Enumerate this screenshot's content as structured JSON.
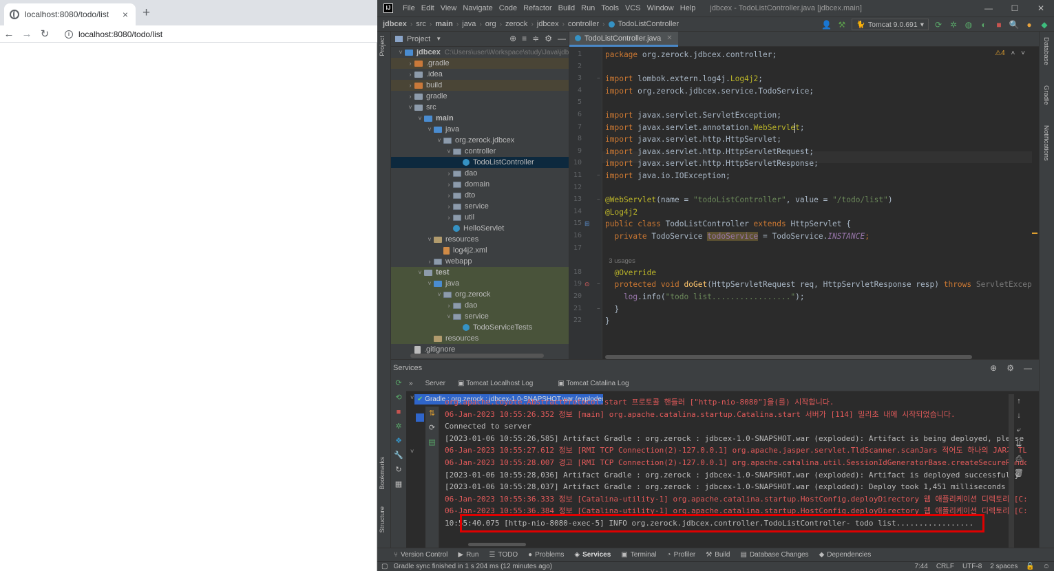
{
  "browser": {
    "tab_title": "localhost:8080/todo/list",
    "tab_close": "×",
    "new_tab": "+",
    "back": "←",
    "forward": "→",
    "reload": "↻",
    "url": "localhost:8080/todo/list"
  },
  "ide": {
    "logo": "IJ",
    "menu": [
      "File",
      "Edit",
      "View",
      "Navigate",
      "Code",
      "Refactor",
      "Build",
      "Run",
      "Tools",
      "VCS",
      "Window",
      "Help"
    ],
    "window_title": "jdbcex - TodoListController.java [jdbcex.main]",
    "win_min": "—",
    "win_max": "☐",
    "win_close": "✕",
    "breadcrumbs": [
      "jdbcex",
      "src",
      "main",
      "java",
      "org",
      "zerock",
      "jdbcex",
      "controller",
      "TodoListController"
    ],
    "run_config": "Tomcat 9.0.691",
    "left_strip": [
      "Project",
      "Bookmarks",
      "Structure"
    ],
    "right_strip": [
      "Database",
      "Gradle",
      "Notifications"
    ],
    "project_panel": {
      "title": "Project",
      "root_path": "C:\\Users\\user\\Workspace\\study\\Java\\jdb",
      "tree": [
        {
          "label": "jdbcex",
          "indent": 0,
          "arrow": "v",
          "icon": "blue",
          "bold": true,
          "bg": "",
          "path": true
        },
        {
          "label": ".gradle",
          "indent": 1,
          "arrow": ">",
          "icon": "orange",
          "bg": "brown"
        },
        {
          "label": ".idea",
          "indent": 1,
          "arrow": ">",
          "icon": "folder",
          "bg": ""
        },
        {
          "label": "build",
          "indent": 1,
          "arrow": ">",
          "icon": "orange",
          "bg": "brown"
        },
        {
          "label": "gradle",
          "indent": 1,
          "arrow": ">",
          "icon": "folder",
          "bg": ""
        },
        {
          "label": "src",
          "indent": 1,
          "arrow": "v",
          "icon": "folder",
          "bg": ""
        },
        {
          "label": "main",
          "indent": 2,
          "arrow": "v",
          "icon": "blue",
          "bold": true,
          "bg": ""
        },
        {
          "label": "java",
          "indent": 3,
          "arrow": "v",
          "icon": "blue",
          "bg": ""
        },
        {
          "label": "org.zerock.jdbcex",
          "indent": 4,
          "arrow": "v",
          "icon": "pkg",
          "bg": ""
        },
        {
          "label": "controller",
          "indent": 5,
          "arrow": "v",
          "icon": "pkg",
          "bg": ""
        },
        {
          "label": "TodoListController",
          "indent": 6,
          "arrow": "",
          "icon": "class",
          "bg": "sel"
        },
        {
          "label": "dao",
          "indent": 5,
          "arrow": ">",
          "icon": "pkg",
          "bg": ""
        },
        {
          "label": "domain",
          "indent": 5,
          "arrow": ">",
          "icon": "pkg",
          "bg": ""
        },
        {
          "label": "dto",
          "indent": 5,
          "arrow": ">",
          "icon": "pkg",
          "bg": ""
        },
        {
          "label": "service",
          "indent": 5,
          "arrow": ">",
          "icon": "pkg",
          "bg": ""
        },
        {
          "label": "util",
          "indent": 5,
          "arrow": ">",
          "icon": "pkg",
          "bg": ""
        },
        {
          "label": "HelloServlet",
          "indent": 5,
          "arrow": "",
          "icon": "class",
          "bg": ""
        },
        {
          "label": "resources",
          "indent": 3,
          "arrow": "v",
          "icon": "res",
          "bg": ""
        },
        {
          "label": "log4j2.xml",
          "indent": 4,
          "arrow": "",
          "icon": "xml",
          "bg": ""
        },
        {
          "label": "webapp",
          "indent": 3,
          "arrow": ">",
          "icon": "pkg",
          "bg": ""
        },
        {
          "label": "test",
          "indent": 2,
          "arrow": "v",
          "icon": "folder",
          "bold": true,
          "bg": "olive"
        },
        {
          "label": "java",
          "indent": 3,
          "arrow": "v",
          "icon": "blue",
          "bg": "olive"
        },
        {
          "label": "org.zerock",
          "indent": 4,
          "arrow": "v",
          "icon": "pkg",
          "bg": "olive"
        },
        {
          "label": "dao",
          "indent": 5,
          "arrow": ">",
          "icon": "pkg",
          "bg": "olive"
        },
        {
          "label": "service",
          "indent": 5,
          "arrow": "v",
          "icon": "pkg",
          "bg": "olive"
        },
        {
          "label": "TodoServiceTests",
          "indent": 6,
          "arrow": "",
          "icon": "class",
          "bg": "olive"
        },
        {
          "label": "resources",
          "indent": 3,
          "arrow": "",
          "icon": "res",
          "bg": "olive"
        },
        {
          "label": ".gitignore",
          "indent": 1,
          "arrow": "",
          "icon": "file",
          "bg": ""
        }
      ]
    },
    "editor": {
      "tab": "TodoListController.java",
      "warnings": "⚠4",
      "line_numbers": [
        "1",
        "2",
        "3",
        "4",
        "5",
        "6",
        "7",
        "8",
        "9",
        "10",
        "11",
        "12",
        "13",
        "14",
        "15",
        "16",
        "17",
        "",
        "18",
        "19",
        "20",
        "21",
        "22"
      ],
      "lines": [
        [
          {
            "t": "package ",
            "c": "kw"
          },
          {
            "t": "org.zerock.jdbcex.controller;",
            "c": ""
          }
        ],
        [],
        [
          {
            "t": "import ",
            "c": "kw"
          },
          {
            "t": "lombok.extern.log4j.",
            "c": ""
          },
          {
            "t": "Log4j2",
            "c": "ann"
          },
          {
            "t": ";",
            "c": ""
          }
        ],
        [
          {
            "t": "import ",
            "c": "kw"
          },
          {
            "t": "org.zerock.jdbcex.service.TodoService;",
            "c": ""
          }
        ],
        [],
        [
          {
            "t": "import ",
            "c": "kw"
          },
          {
            "t": "javax.servlet.ServletException;",
            "c": ""
          }
        ],
        [
          {
            "t": "import ",
            "c": "kw"
          },
          {
            "t": "javax.servlet.annotation.",
            "c": ""
          },
          {
            "t": "WebServlet",
            "c": "ann"
          },
          {
            "t": ";",
            "c": ""
          }
        ],
        [
          {
            "t": "import ",
            "c": "kw"
          },
          {
            "t": "javax.servlet.http.HttpServlet;",
            "c": ""
          }
        ],
        [
          {
            "t": "import ",
            "c": "kw"
          },
          {
            "t": "javax.servlet.http.HttpServletRequest;",
            "c": ""
          }
        ],
        [
          {
            "t": "import ",
            "c": "kw"
          },
          {
            "t": "javax.servlet.http.HttpServletResponse;",
            "c": ""
          }
        ],
        [
          {
            "t": "import ",
            "c": "kw"
          },
          {
            "t": "java.io.IOException;",
            "c": ""
          }
        ],
        [],
        [
          {
            "t": "@WebServlet",
            "c": "ann"
          },
          {
            "t": "(name = ",
            "c": ""
          },
          {
            "t": "\"todoListController\"",
            "c": "str"
          },
          {
            "t": ", value = ",
            "c": ""
          },
          {
            "t": "\"/todo/list\"",
            "c": "str"
          },
          {
            "t": ")",
            "c": ""
          }
        ],
        [
          {
            "t": "@Log4j2",
            "c": "ann"
          }
        ],
        [
          {
            "t": "public class ",
            "c": "kw"
          },
          {
            "t": "TodoListController ",
            "c": ""
          },
          {
            "t": "extends ",
            "c": "kw"
          },
          {
            "t": "HttpServlet {",
            "c": ""
          }
        ],
        [
          {
            "t": "  private ",
            "c": "kw"
          },
          {
            "t": "TodoService ",
            "c": ""
          },
          {
            "t": "todoService",
            "c": "fld hl"
          },
          {
            "t": " = TodoService.",
            "c": ""
          },
          {
            "t": "INSTANCE",
            "c": "sfld"
          },
          {
            "t": ";",
            "c": "kw"
          }
        ],
        [],
        [
          {
            "t": "  3 usages",
            "c": "hint"
          }
        ],
        [
          {
            "t": "  @Override",
            "c": "ann"
          }
        ],
        [
          {
            "t": "  protected void ",
            "c": "kw"
          },
          {
            "t": "doGet",
            "c": "meth"
          },
          {
            "t": "(HttpServletRequest req, HttpServletResponse resp) ",
            "c": ""
          },
          {
            "t": "throws ",
            "c": "kw"
          },
          {
            "t": "ServletException, IO",
            "c": "dimtxt"
          }
        ],
        [
          {
            "t": "    log",
            "c": "fld"
          },
          {
            "t": ".info(",
            "c": ""
          },
          {
            "t": "\"todo list.................\"",
            "c": "str"
          },
          {
            "t": ");",
            "c": ""
          }
        ],
        [
          {
            "t": "  }",
            "c": ""
          }
        ],
        [
          {
            "t": "}",
            "c": ""
          }
        ]
      ]
    },
    "services": {
      "title": "Services",
      "tabs": [
        "Server",
        "Tomcat Localhost Log",
        "Tomcat Catalina Log"
      ],
      "selected_node": "Gradle : org.zerock : jdbcex-1.0-SNAPSHOT.war (exploded)",
      "console": [
        {
          "t": "org.apache.coyote.AbstractProtocol.start 프로토콜 핸들러 [\"http-nio-8080\"]을(를) 시작합니다.",
          "c": "red"
        },
        {
          "t": "06-Jan-2023 10:55:26.352 정보 [main] org.apache.catalina.startup.Catalina.start 서버가 [114] 밀리초 내에 시작되었습니다.",
          "c": "red"
        },
        {
          "t": "Connected to server",
          "c": "gray"
        },
        {
          "t": "[2023-01-06 10:55:26,585] Artifact Gradle : org.zerock : jdbcex-1.0-SNAPSHOT.war (exploded): Artifact is being deployed, please wai",
          "c": "gray"
        },
        {
          "t": "06-Jan-2023 10:55:27.612 정보 [RMI TCP Connection(2)-127.0.0.1] org.apache.jasper.servlet.TldScanner.scanJars 적어도 하나의 JAR가 TLD들",
          "c": "red"
        },
        {
          "t": "06-Jan-2023 10:55:28.007 경고 [RMI TCP Connection(2)-127.0.0.1] org.apache.catalina.util.SessionIdGeneratorBase.createSecureRandom [",
          "c": "red"
        },
        {
          "t": "[2023-01-06 10:55:28,036] Artifact Gradle : org.zerock : jdbcex-1.0-SNAPSHOT.war (exploded): Artifact is deployed successfully",
          "c": "gray"
        },
        {
          "t": "[2023-01-06 10:55:28,037] Artifact Gradle : org.zerock : jdbcex-1.0-SNAPSHOT.war (exploded): Deploy took 1,451 milliseconds",
          "c": "gray"
        },
        {
          "t": "06-Jan-2023 10:55:36.333 정보 [Catalina-utility-1] org.apache.catalina.startup.HostConfig.deployDirectory 웹 애플리케이션 디렉토리 [C:\\P",
          "c": "red"
        },
        {
          "t": "06-Jan-2023 10:55:36.384 정보 [Catalina-utility-1] org.apache.catalina.startup.HostConfig.deployDirectory 웹 애플리케이션 디렉토리 [C:\\P",
          "c": "red"
        },
        {
          "t": "10:55:40.075 [http-nio-8080-exec-5] INFO  org.zerock.jdbcex.controller.TodoListController- todo list.................",
          "c": "gray"
        }
      ]
    },
    "bottom_tabs": [
      {
        "label": "Version Control",
        "icon": "⑂"
      },
      {
        "label": "Run",
        "icon": "▶"
      },
      {
        "label": "TODO",
        "icon": "☰"
      },
      {
        "label": "Problems",
        "icon": "●"
      },
      {
        "label": "Services",
        "icon": "◈",
        "active": true
      },
      {
        "label": "Terminal",
        "icon": "▣"
      },
      {
        "label": "Profiler",
        "icon": "◔"
      },
      {
        "label": "Build",
        "icon": "⚒"
      },
      {
        "label": "Database Changes",
        "icon": "▤"
      },
      {
        "label": "Dependencies",
        "icon": "◆"
      }
    ],
    "status": {
      "message": "Gradle sync finished in 1 s 204 ms (12 minutes ago)",
      "position": "7:44",
      "line_sep": "CRLF",
      "encoding": "UTF-8",
      "indent": "2 spaces"
    }
  }
}
